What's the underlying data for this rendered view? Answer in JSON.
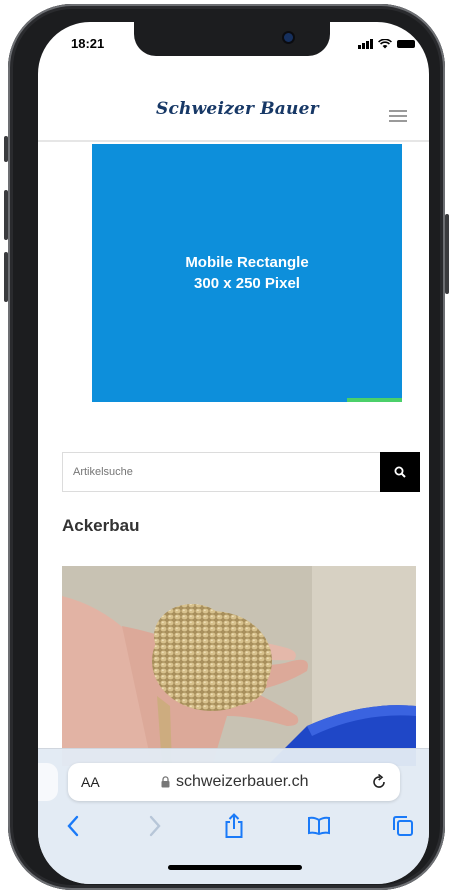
{
  "status_bar": {
    "time": "18:21"
  },
  "header": {
    "logo_text": "Schweizer Bauer"
  },
  "ad": {
    "line1": "Mobile Rectangle",
    "line2": "300 x 250 Pixel"
  },
  "search": {
    "placeholder": "Artikelsuche"
  },
  "section": {
    "title": "Ackerbau"
  },
  "browser": {
    "text_size_label": "AA",
    "url": "schweizerbauer.ch"
  },
  "colors": {
    "ad_blue": "#0d8fdb",
    "brand_navy": "#173866",
    "ios_blue": "#1a7af8"
  },
  "icons": [
    "menu-icon",
    "search-icon",
    "lock-icon",
    "reload-icon",
    "back-icon",
    "forward-icon",
    "share-icon",
    "bookmarks-icon",
    "tabs-icon"
  ]
}
